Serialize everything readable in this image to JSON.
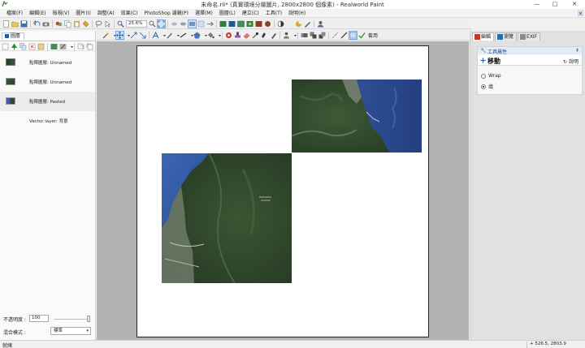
{
  "window": {
    "title": "未命名.rli* (真實環境分層圖片, 2800x2800 個像素) - Realworld Paint"
  },
  "menu": [
    "檔案(F)",
    "編輯(E)",
    "檢視(V)",
    "圖片(I)",
    "調整(A)",
    "效果(C)",
    "PhotoShop 濾鏡(P)",
    "選擇(M)",
    "圖層(L)",
    "建立(C)",
    "工具(T)",
    "說明(H)"
  ],
  "toolbar": {
    "zoom_value": "25.6%",
    "apply_label": "套用"
  },
  "layers_panel": {
    "tab_label": "圖層",
    "layers": [
      {
        "name": "點陣圖層: Unnamed",
        "has_thumb": true
      },
      {
        "name": "點陣圖層: Unnamed",
        "has_thumb": true
      },
      {
        "name": "點陣圖層: Pasted",
        "has_thumb": true
      },
      {
        "name": "Vector layer: 背景",
        "has_thumb": false
      }
    ],
    "opacity_label": "不透明度 :",
    "opacity_value": "100",
    "blend_label": "混合模式 :",
    "blend_value": "標準"
  },
  "right_panel": {
    "tabs": [
      "編輯",
      "瀏覽",
      "EXIF"
    ],
    "tool_props_title": "工具屬性",
    "tool_name": "移動",
    "help_label": "說明",
    "options": [
      {
        "label": "Wrap",
        "selected": false
      },
      {
        "label": "填",
        "selected": true
      }
    ]
  },
  "status": {
    "text": "就緒",
    "coords": "526.5, 2803.9"
  },
  "colors": {
    "canvas_bg": "#b3b3b3",
    "accent": "#1f4f8f",
    "forest": "#2f4a2b",
    "sea": "#3a5fa8"
  }
}
